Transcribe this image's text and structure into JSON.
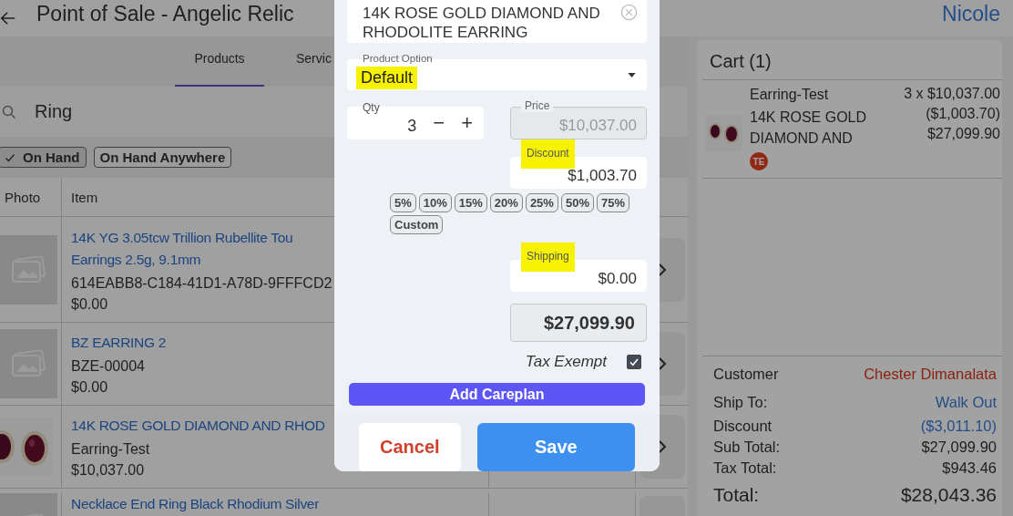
{
  "header": {
    "title": "Point of Sale - Angelic Relic",
    "user": "Nicole"
  },
  "tabs": [
    {
      "label": "Products",
      "selected": true
    },
    {
      "label": "Servic",
      "selected": false
    }
  ],
  "search": {
    "value": "Ring"
  },
  "filters": [
    {
      "label": "On Hand",
      "checked": true
    },
    {
      "label": "On Hand Anywhere",
      "checked": false
    }
  ],
  "table": {
    "columns": [
      "Photo",
      "Item"
    ],
    "rows": [
      {
        "kind": "placeholder",
        "title_lines": [
          "14K YG 3.05tcw Trillion Rubellite Tou",
          "Earrings 2.5g, 9.1mm"
        ],
        "sku": "614EABB8-C184-41D1-A78D-9FFFCD2",
        "price": "$0.00"
      },
      {
        "kind": "placeholder",
        "title_lines": [
          "BZ EARRING 2"
        ],
        "sku": "BZE-00004",
        "price": "$0.00"
      },
      {
        "kind": "picture",
        "title_lines": [
          "14K ROSE GOLD DIAMOND AND RHOD"
        ],
        "sku": "Earring-Test",
        "price": "$10,037.00"
      },
      {
        "kind": "placeholder",
        "title_lines": [
          "Necklace End Ring Black Rhodium Silver"
        ]
      }
    ]
  },
  "cart": {
    "title": "Cart (1)",
    "items": [
      {
        "name": "Earring-Test",
        "description": "14K ROSE GOLD DIAMOND AND",
        "badge": "TE",
        "qty_price": "3 x $10,037.00",
        "discount": "($1,003.70)",
        "total": "$27,099.90"
      }
    ],
    "summary": [
      {
        "label": "Customer",
        "value": "Chester Dimanalata",
        "kind": "customer"
      },
      {
        "label": "Ship To:",
        "value": "Walk Out",
        "kind": "link"
      },
      {
        "label": "Discount",
        "value": "($3,011.10)",
        "kind": "link"
      },
      {
        "label": "Sub Total:",
        "value": "$27,099.90",
        "kind": "plain"
      },
      {
        "label": "Tax Total:",
        "value": "$943.46",
        "kind": "plain"
      },
      {
        "label": "Total:",
        "value": "$28,043.36",
        "kind": "total"
      }
    ]
  },
  "dialog": {
    "description": "14K ROSE GOLD DIAMOND AND RHODOLITE EARRING",
    "product_option": {
      "label": "Product Option",
      "value": "Default",
      "highlighted": true
    },
    "qty": {
      "label": "Qty",
      "value": "3",
      "decrement": "−",
      "increment": "+"
    },
    "price": {
      "label": "Price",
      "value": "$10,037.00",
      "disabled": true,
      "highlighted": false
    },
    "discount": {
      "label": "Discount",
      "value": "$1,003.70",
      "disabled": false,
      "highlighted": true
    },
    "discount_presets": [
      "5%",
      "10%",
      "15%",
      "20%",
      "25%",
      "50%",
      "75%",
      "Custom"
    ],
    "shipping": {
      "label": "Shipping",
      "value": "$0.00",
      "disabled": false,
      "highlighted": true
    },
    "line_total": "$27,099.90",
    "tax_exempt": {
      "label": "Tax Exempt",
      "checked": true
    },
    "careplan_button": "Add Careplan",
    "cancel_button": "Cancel",
    "save_button": "Save"
  }
}
